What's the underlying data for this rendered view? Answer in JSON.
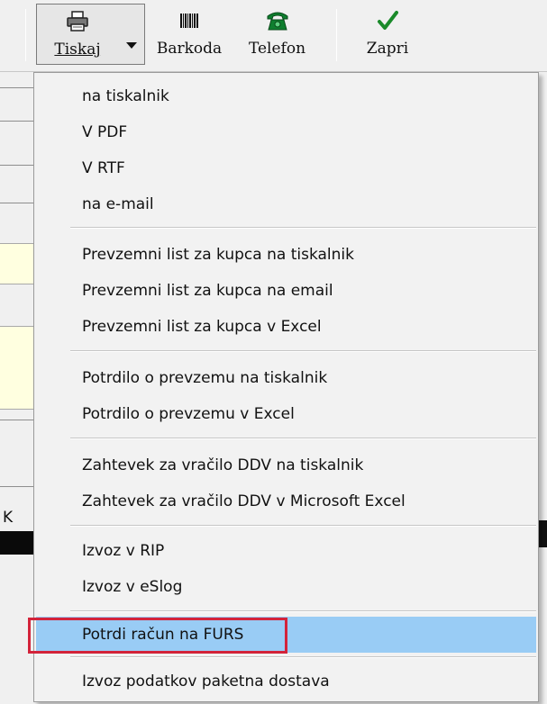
{
  "toolbar": {
    "print_label": "Tiskaj",
    "barcode_label": "Barkoda",
    "phone_label": "Telefon",
    "close_label": "Zapri",
    "accent_green": "#1a8a2a"
  },
  "background": {
    "partial_label": "K"
  },
  "menu": {
    "groups": [
      [
        "na tiskalnik",
        "V PDF",
        "V RTF",
        "na e-mail"
      ],
      [
        "Prevzemni list za kupca na tiskalnik",
        "Prevzemni list za kupca na email",
        "Prevzemni list za kupca v Excel"
      ],
      [
        "Potrdilo o prevzemu na tiskalnik",
        "Potrdilo o prevzemu v Excel"
      ],
      [
        "Zahtevek za vračilo DDV na tiskalnik",
        "Zahtevek za vračilo DDV v Microsoft Excel"
      ],
      [
        "Izvoz v RIP",
        "Izvoz v eSlog"
      ],
      [
        "Potrdi račun na FURS"
      ],
      [
        "Izvoz podatkov paketna dostava"
      ]
    ],
    "highlighted_item": "Potrdi račun na FURS",
    "highlight_color": "#99ccf5",
    "annotation_color": "#d3233a"
  }
}
